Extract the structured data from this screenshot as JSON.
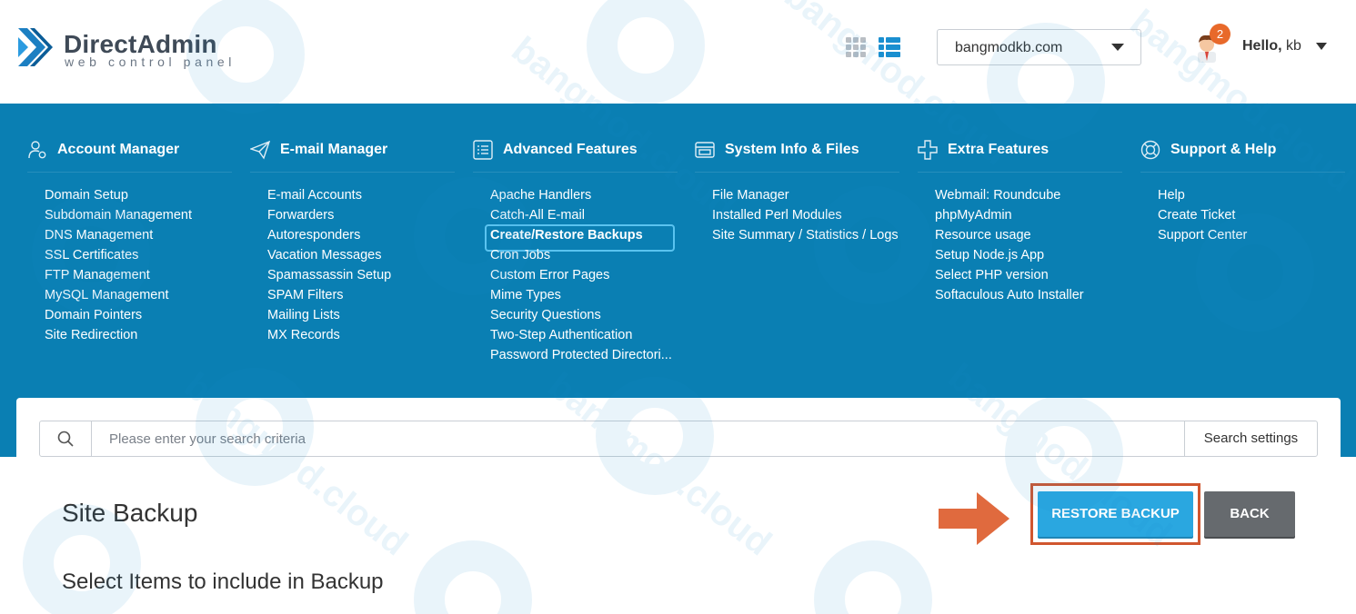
{
  "header": {
    "logo_name": "DirectAdmin",
    "logo_tagline": "web control panel",
    "domain_selected": "bangmodkb.com",
    "notification_count": "2",
    "greeting": "Hello,",
    "username": "kb"
  },
  "nav": {
    "columns": [
      {
        "title": "Account Manager",
        "icon": "user-gear-icon",
        "items": [
          "Domain Setup",
          "Subdomain Management",
          "DNS Management",
          "SSL Certificates",
          "FTP Management",
          "MySQL Management",
          "Domain Pointers",
          "Site Redirection"
        ]
      },
      {
        "title": "E-mail Manager",
        "icon": "paper-plane-icon",
        "items": [
          "E-mail Accounts",
          "Forwarders",
          "Autoresponders",
          "Vacation Messages",
          "Spamassassin Setup",
          "SPAM Filters",
          "Mailing Lists",
          "MX Records"
        ]
      },
      {
        "title": "Advanced Features",
        "icon": "list-icon",
        "items": [
          "Apache Handlers",
          "Catch-All E-mail",
          "Create/Restore Backups",
          "Cron Jobs",
          "Custom Error Pages",
          "Mime Types",
          "Security Questions",
          "Two-Step Authentication",
          "Password Protected Directori..."
        ]
      },
      {
        "title": "System Info & Files",
        "icon": "server-icon",
        "items": [
          "File Manager",
          "Installed Perl Modules",
          "Site Summary / Statistics / Logs"
        ]
      },
      {
        "title": "Extra Features",
        "icon": "plus-icon",
        "items": [
          "Webmail: Roundcube",
          "phpMyAdmin",
          "Resource usage",
          "Setup Node.js App",
          "Select PHP version",
          "Softaculous Auto Installer"
        ]
      },
      {
        "title": "Support & Help",
        "icon": "lifebuoy-icon",
        "items": [
          "Help",
          "Create Ticket",
          "Support Center"
        ]
      }
    ]
  },
  "search": {
    "placeholder": "Please enter your search criteria",
    "settings_label": "Search settings"
  },
  "main": {
    "page_title": "Site Backup",
    "section_title": "Select Items to include in Backup",
    "restore_button": "RESTORE BACKUP",
    "back_button": "BACK"
  },
  "colors": {
    "nav_bg": "#0a7fb3",
    "restore_btn": "#2aa7e0",
    "back_btn": "#666a6e",
    "highlight": "#d0562f",
    "badge": "#e8692a"
  },
  "watermark": "bangmod.cloud"
}
